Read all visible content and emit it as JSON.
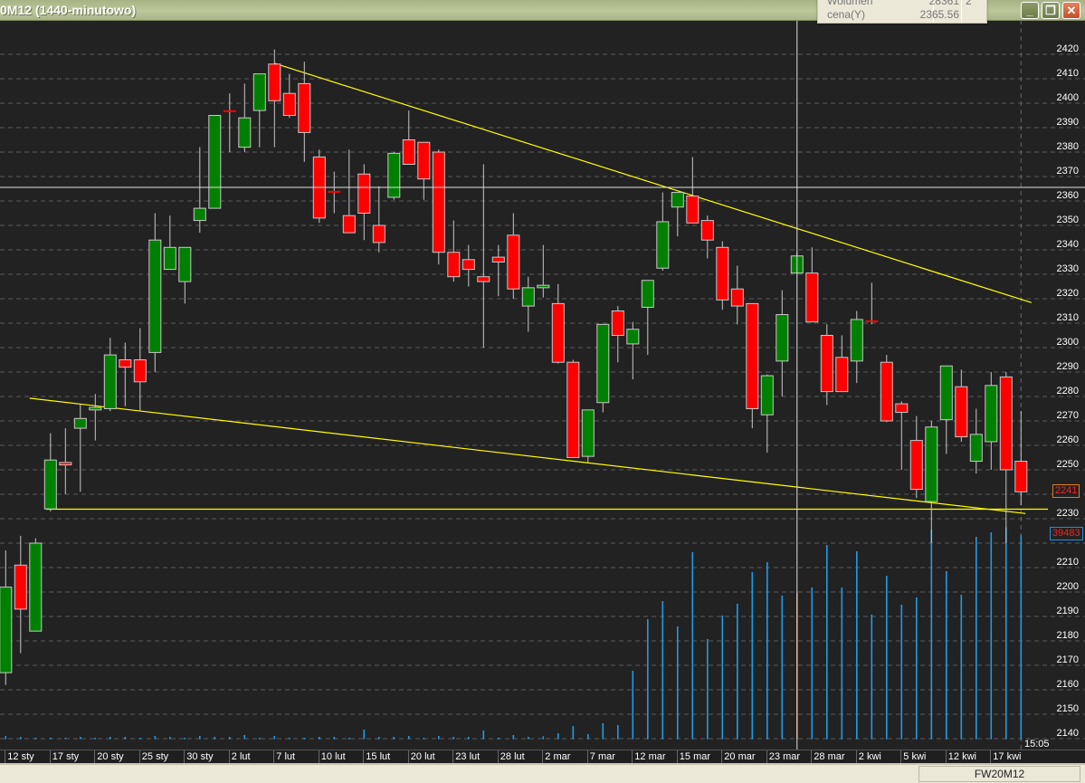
{
  "window": {
    "title": "0M12 (1440-minutowo)",
    "buttons": {
      "minimize": "_",
      "restore": "❐",
      "close": "✕"
    }
  },
  "infobox": {
    "rows": [
      {
        "label": "Wolumen",
        "value": "28361",
        "extra": "2"
      },
      {
        "label": "cena(Y)",
        "value": "2365.56",
        "extra": ""
      }
    ]
  },
  "statusbar": {
    "ticker": "FW20M12"
  },
  "time_label": "15:05",
  "last_price_tag": "2241",
  "last_volume_tag": "39483",
  "colors": {
    "up": "#008000",
    "down": "#ff0000",
    "volume": "#1e9be8",
    "selected_volume": "#e8641e",
    "trendline": "#ffff00",
    "background": "#222222"
  },
  "chart_data": {
    "type": "candlestick",
    "title": "0M12 (1440-minutowo)",
    "ylim": [
      2140,
      2420
    ],
    "yticks": [
      2420,
      2410,
      2400,
      2390,
      2380,
      2370,
      2360,
      2350,
      2340,
      2330,
      2320,
      2310,
      2300,
      2290,
      2280,
      2270,
      2260,
      2250,
      2240,
      2230,
      2220,
      2210,
      2200,
      2190,
      2180,
      2170,
      2160,
      2150,
      2140
    ],
    "xtick_labels": [
      "12 sty",
      "17 sty",
      "20 sty",
      "25 sty",
      "30 sty",
      "2 lut",
      "7 lut",
      "10 lut",
      "15 lut",
      "20 lut",
      "23 lut",
      "28 lut",
      "2 mar",
      "7 mar",
      "12 mar",
      "15 mar",
      "20 mar",
      "23 mar",
      "28 mar",
      "2 kwi",
      "5 kwi",
      "12 kwi",
      "17 kwi"
    ],
    "xtick_every_n_candles": 3,
    "ohlc": [
      [
        2167,
        2217,
        2162,
        2202
      ],
      [
        2211,
        2223,
        2175,
        2193
      ],
      [
        2184,
        2222,
        2184,
        2220
      ],
      [
        2234,
        2265,
        2233,
        2254
      ],
      [
        2253,
        2267,
        2240,
        2252
      ],
      [
        2267,
        2277,
        2241,
        2271
      ],
      [
        2274.5,
        2281,
        2262,
        2275.5
      ],
      [
        2275,
        2304,
        2274,
        2297
      ],
      [
        2295,
        2302,
        2276,
        2292
      ],
      [
        2295,
        2308,
        2274,
        2286
      ],
      [
        2298,
        2355,
        2290,
        2344
      ],
      [
        2332,
        2354,
        2332,
        2341
      ],
      [
        2327,
        2341,
        2318,
        2341
      ],
      [
        2352,
        2382,
        2347,
        2357
      ],
      [
        2357,
        2395,
        2357,
        2395
      ],
      [
        2397,
        2404,
        2380,
        2396.5
      ],
      [
        2382,
        2408,
        2380,
        2394
      ],
      [
        2397,
        2412,
        2382,
        2412
      ],
      [
        2416,
        2422,
        2382,
        2401
      ],
      [
        2404,
        2412,
        2394,
        2395
      ],
      [
        2408,
        2417,
        2376,
        2388
      ],
      [
        2378,
        2381,
        2351,
        2353
      ],
      [
        2364,
        2372,
        2355,
        2363.5
      ],
      [
        2354,
        2381,
        2347,
        2347
      ],
      [
        2371,
        2375,
        2344,
        2355
      ],
      [
        2350,
        2366,
        2339,
        2343
      ],
      [
        2361.5,
        2380,
        2360.5,
        2379.5
      ],
      [
        2385,
        2397,
        2375,
        2375
      ],
      [
        2384,
        2384,
        2360.5,
        2369
      ],
      [
        2380,
        2381,
        2334,
        2339
      ],
      [
        2339,
        2352,
        2327,
        2329
      ],
      [
        2336,
        2342,
        2325,
        2332
      ],
      [
        2329,
        2375,
        2300,
        2327
      ],
      [
        2337,
        2342,
        2321,
        2335
      ],
      [
        2346,
        2355,
        2320,
        2324
      ],
      [
        2317,
        2329,
        2306.5,
        2324.5
      ],
      [
        2324.5,
        2342,
        2320.5,
        2325.5
      ],
      [
        2318,
        2326,
        2293.5,
        2294
      ],
      [
        2294,
        2295,
        2255,
        2255
      ],
      [
        2255.5,
        2274.5,
        2253,
        2274.5
      ],
      [
        2277.5,
        2309.5,
        2273.5,
        2309.5
      ],
      [
        2315,
        2317,
        2294,
        2305
      ],
      [
        2301.5,
        2310.5,
        2287,
        2307.5
      ],
      [
        2316.5,
        2327.5,
        2297,
        2327.5
      ],
      [
        2332.5,
        2363.5,
        2331.5,
        2351.5
      ],
      [
        2357.5,
        2363.5,
        2345.5,
        2363.5
      ],
      [
        2362,
        2378,
        2351,
        2351
      ],
      [
        2352,
        2354,
        2336.5,
        2344
      ],
      [
        2341,
        2343.5,
        2315.5,
        2319.5
      ],
      [
        2324,
        2333.5,
        2309.5,
        2317
      ],
      [
        2318,
        2318,
        2267,
        2275
      ],
      [
        2272.5,
        2289,
        2257,
        2288.5
      ],
      [
        2294.5,
        2323.5,
        2280,
        2313.5
      ],
      [
        2330.5,
        2339,
        2330,
        2337.5
      ],
      [
        2330.5,
        2341,
        2310.5,
        2310.5
      ],
      [
        2305,
        2309.5,
        2276.5,
        2282
      ],
      [
        2296,
        2305,
        2282,
        2282
      ],
      [
        2294.5,
        2315,
        2285.5,
        2311.5
      ],
      [
        2311,
        2326.5,
        2309.5,
        2310.5
      ],
      [
        2294,
        2297,
        2269.5,
        2270
      ],
      [
        2277,
        2278,
        2250,
        2273.5
      ],
      [
        2262,
        2272,
        2238.5,
        2242
      ],
      [
        2237,
        2270,
        2220,
        2267.5
      ],
      [
        2270.5,
        2292.5,
        2256.5,
        2292.5
      ],
      [
        2284,
        2291,
        2261.5,
        2263.5
      ],
      [
        2253.5,
        2275,
        2248.5,
        2264.5
      ],
      [
        2261.5,
        2290,
        2250,
        2284.5
      ],
      [
        2288,
        2290,
        2220,
        2250
      ],
      [
        2253.5,
        2274,
        2235.5,
        2241
      ]
    ],
    "volume": [
      650,
      470,
      300,
      300,
      300,
      470,
      300,
      470,
      470,
      300,
      650,
      470,
      300,
      650,
      470,
      470,
      820,
      300,
      650,
      300,
      300,
      470,
      470,
      300,
      1870,
      470,
      470,
      650,
      300,
      650,
      470,
      470,
      1700,
      300,
      820,
      470,
      580,
      1170,
      2570,
      1000,
      3100,
      2740,
      13250,
      23220,
      26720,
      21820,
      36170,
      19370,
      23920,
      26190,
      32320,
      34240,
      27770,
      28350,
      29340,
      37570,
      29340,
      36340,
      24090,
      31620,
      26020,
      27420,
      40500,
      32500,
      27950,
      39150,
      40000,
      41000,
      39483
    ],
    "volume_max_ref": 39483,
    "selected_index": 53,
    "crosshair_price": 2365.56,
    "current_bar_marker_index": 68,
    "trendlines": [
      {
        "name": "upper-resistance",
        "from": [
          18,
          2416.3
        ],
        "to": [
          68.7,
          2318.4
        ]
      },
      {
        "name": "lower-support",
        "from": [
          1.6,
          2279.3
        ],
        "to": [
          68.3,
          2232.1
        ]
      },
      {
        "name": "horizontal-support",
        "from": [
          2.7,
          2233.9
        ],
        "to": [
          69.8,
          2233.9
        ]
      }
    ]
  }
}
